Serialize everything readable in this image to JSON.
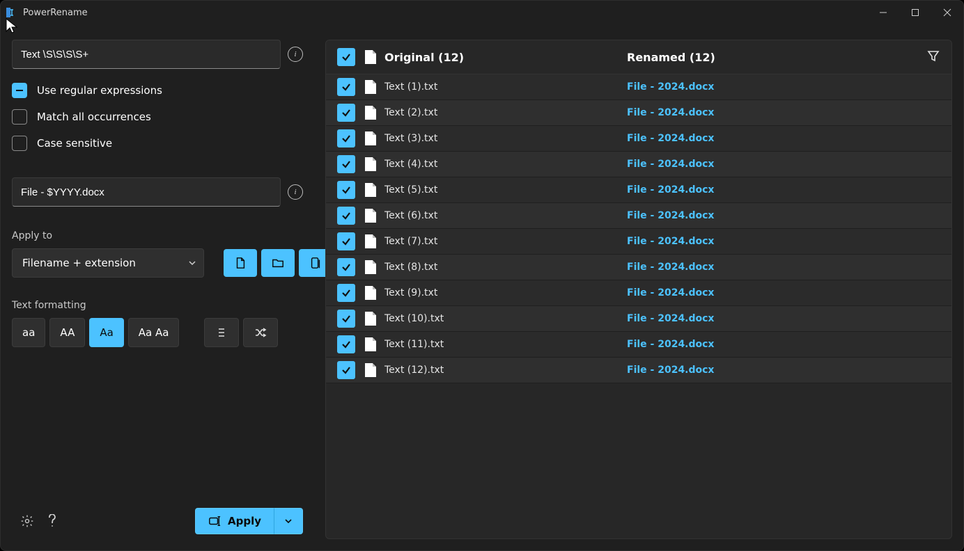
{
  "app": {
    "title": "PowerRename"
  },
  "inputs": {
    "search": "Text \\S\\S\\S\\S+",
    "replace": "File - $YYYY.docx"
  },
  "options": {
    "regex": {
      "label": "Use regular expressions",
      "state": "indeterminate"
    },
    "matchAll": {
      "label": "Match all occurrences",
      "state": "off"
    },
    "caseSensitive": {
      "label": "Case sensitive",
      "state": "off"
    }
  },
  "applyTo": {
    "label": "Apply to",
    "selected": "Filename + extension"
  },
  "formatting": {
    "label": "Text formatting",
    "lower": "aa",
    "upper": "AA",
    "title": "Aa",
    "word": "Aa Aa"
  },
  "apply_label": "Apply",
  "columns": {
    "original": "Original (12)",
    "renamed": "Renamed (12)"
  },
  "rows": [
    {
      "checked": true,
      "original": "Text (1).txt",
      "renamed": "File - 2024.docx"
    },
    {
      "checked": true,
      "original": "Text (2).txt",
      "renamed": "File - 2024.docx"
    },
    {
      "checked": true,
      "original": "Text (3).txt",
      "renamed": "File - 2024.docx"
    },
    {
      "checked": true,
      "original": "Text (4).txt",
      "renamed": "File - 2024.docx"
    },
    {
      "checked": true,
      "original": "Text (5).txt",
      "renamed": "File - 2024.docx"
    },
    {
      "checked": true,
      "original": "Text (6).txt",
      "renamed": "File - 2024.docx"
    },
    {
      "checked": true,
      "original": "Text (7).txt",
      "renamed": "File - 2024.docx"
    },
    {
      "checked": true,
      "original": "Text (8).txt",
      "renamed": "File - 2024.docx"
    },
    {
      "checked": true,
      "original": "Text (9).txt",
      "renamed": "File - 2024.docx"
    },
    {
      "checked": true,
      "original": "Text (10).txt",
      "renamed": "File - 2024.docx"
    },
    {
      "checked": true,
      "original": "Text (11).txt",
      "renamed": "File - 2024.docx"
    },
    {
      "checked": true,
      "original": "Text (12).txt",
      "renamed": "File - 2024.docx"
    }
  ],
  "colors": {
    "accent": "#4cc2ff"
  }
}
